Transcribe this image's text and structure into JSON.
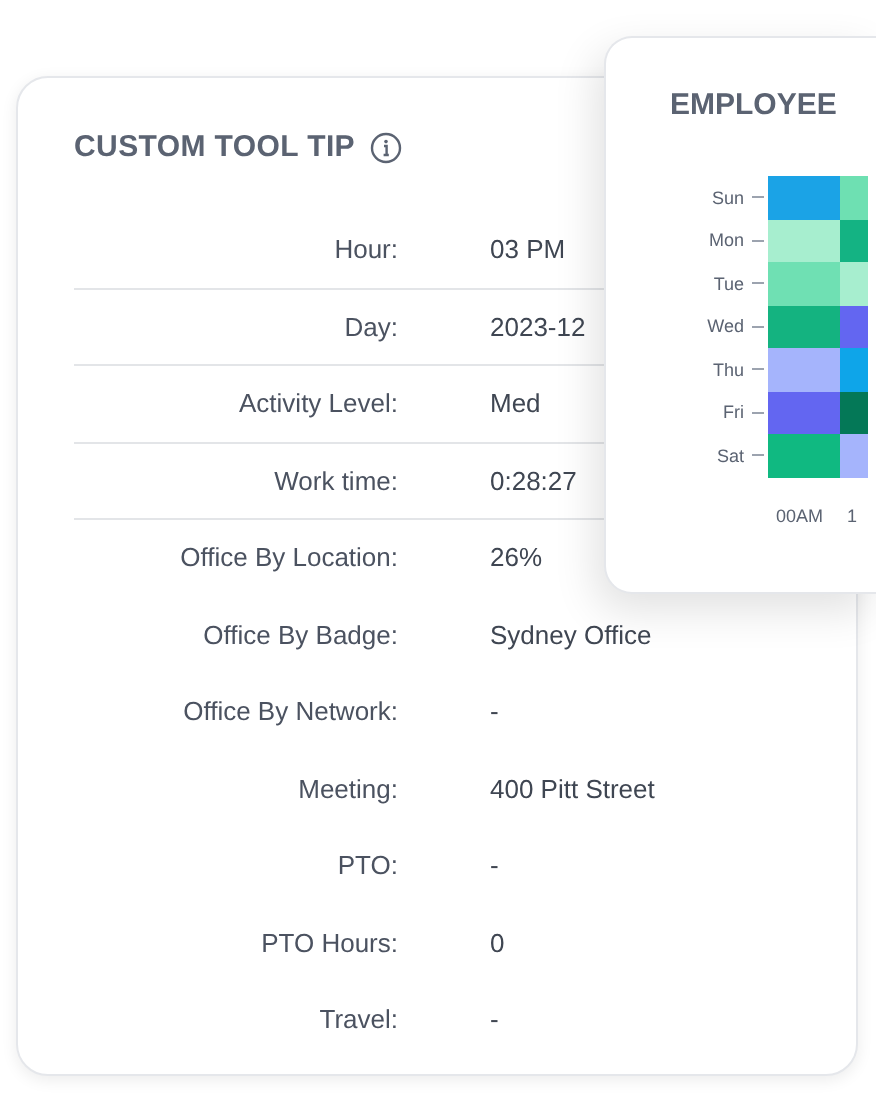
{
  "tooltip_card": {
    "title": "CUSTOM TOOL TIP",
    "rows": [
      {
        "label": "Hour:",
        "value": "03 PM",
        "divider": true
      },
      {
        "label": "Day:",
        "value": "2023-12",
        "divider": true
      },
      {
        "label": "Activity Level:",
        "value": "Med",
        "divider": true
      },
      {
        "label": "Work time:",
        "value": "0:28:27",
        "divider": true
      },
      {
        "label": "Office By Location:",
        "value": "26%",
        "divider": false
      },
      {
        "label": "Office By Badge:",
        "value": "Sydney Office",
        "divider": false
      },
      {
        "label": "Office By Network:",
        "value": "-",
        "divider": false
      },
      {
        "label": "Meeting:",
        "value": "400 Pitt Street",
        "divider": false
      },
      {
        "label": "PTO:",
        "value": "-",
        "divider": false
      },
      {
        "label": "PTO Hours:",
        "value": "0",
        "divider": false
      },
      {
        "label": "Travel:",
        "value": "-",
        "divider": false
      }
    ]
  },
  "heatmap_card": {
    "title": "EMPLOYEE",
    "rows": [
      {
        "label": "Sun",
        "cells": [
          {
            "color": "#1ba3e6"
          },
          {
            "color": "#6ee0b2"
          }
        ]
      },
      {
        "label": "Mon",
        "cells": [
          {
            "color": "#a7eecf"
          },
          {
            "color": "#14b383"
          }
        ]
      },
      {
        "label": "Tue",
        "cells": [
          {
            "color": "#6fe0b3"
          },
          {
            "color": "#a7eecf"
          }
        ]
      },
      {
        "label": "Wed",
        "cells": [
          {
            "color": "#14b380"
          },
          {
            "color": "#6366f1"
          }
        ]
      },
      {
        "label": "Thu",
        "cells": [
          {
            "color": "#a5b4fc"
          },
          {
            "color": "#0ea5e9"
          }
        ]
      },
      {
        "label": "Fri",
        "cells": [
          {
            "color": "#6366f1"
          },
          {
            "color": "#047857"
          }
        ]
      },
      {
        "label": "Sat",
        "cells": [
          {
            "color": "#10b981"
          },
          {
            "color": "#a5b4fc"
          }
        ]
      }
    ],
    "x_labels": [
      "00AM",
      "1"
    ]
  }
}
